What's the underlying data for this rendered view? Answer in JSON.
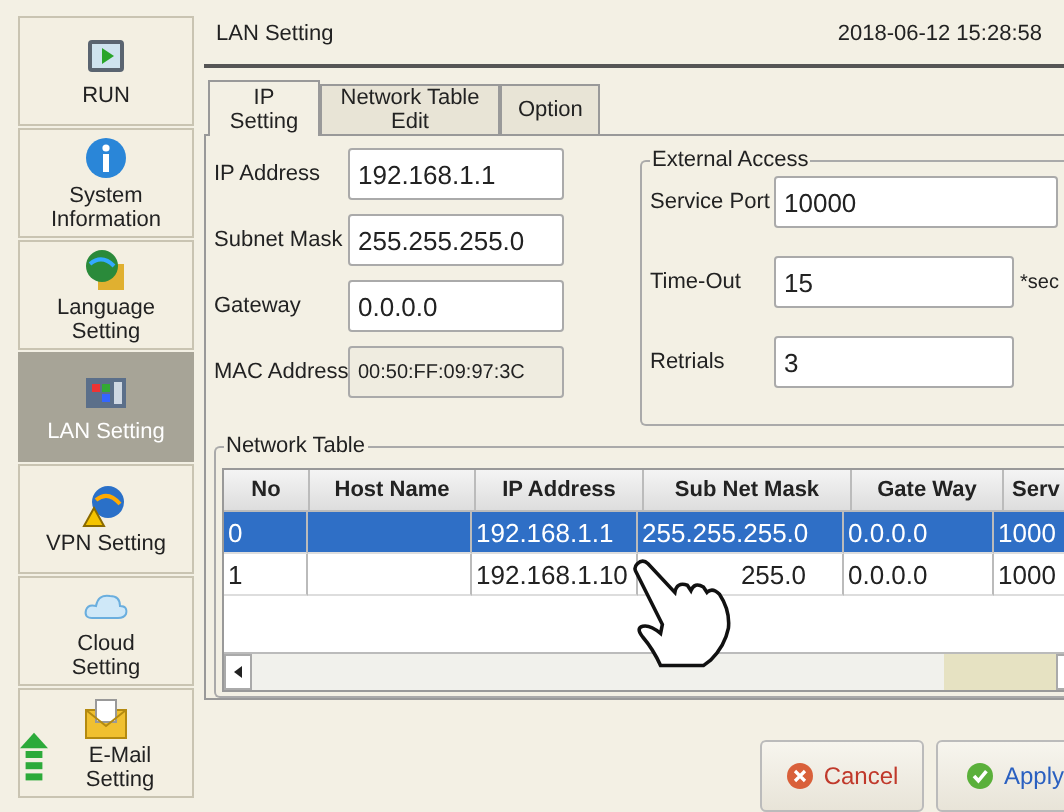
{
  "sidebar": {
    "items": [
      {
        "kind": "run",
        "label": "RUN",
        "selected": false
      },
      {
        "kind": "info",
        "label": "System Information",
        "selected": false
      },
      {
        "kind": "language",
        "label": "Language Setting",
        "selected": false
      },
      {
        "kind": "lan",
        "label": "LAN Setting",
        "selected": true
      },
      {
        "kind": "vpn",
        "label": "VPN Setting",
        "selected": false
      },
      {
        "kind": "cloud",
        "label": "Cloud Setting",
        "selected": false
      },
      {
        "kind": "mail",
        "label": "E-Mail Setting",
        "selected": false
      }
    ]
  },
  "header": {
    "title": "LAN Setting",
    "datetime": "2018-06-12  15:28:58"
  },
  "tabs": [
    {
      "label": "IP Setting",
      "selected": true
    },
    {
      "label": "Network Table Edit",
      "selected": false
    },
    {
      "label": "Option",
      "selected": false
    }
  ],
  "ip_fields": [
    {
      "label": "IP Address",
      "value": "192.168.1.1",
      "disabled": false
    },
    {
      "label": "Subnet Mask",
      "value": "255.255.255.0",
      "disabled": false
    },
    {
      "label": "Gateway",
      "value": "0.0.0.0",
      "disabled": false
    },
    {
      "label": "MAC Address",
      "value": "00:50:FF:09:97:3C",
      "disabled": true
    }
  ],
  "external_access": {
    "title": "External Access",
    "fields": [
      {
        "label": "Service Port",
        "value": "10000"
      },
      {
        "label": "Time-Out",
        "value": "15",
        "unit": "*sec"
      },
      {
        "label": "Retrials",
        "value": "3"
      }
    ]
  },
  "network_table": {
    "title": "Network Table",
    "columns": [
      "No",
      "Host Name",
      "IP Address",
      "Sub Net Mask",
      "Gate Way",
      "Serv"
    ],
    "rows": [
      {
        "selected": true,
        "cells": [
          "0",
          "",
          "192.168.1.1",
          "255.255.255.0",
          "0.0.0.0",
          "1000"
        ]
      },
      {
        "selected": false,
        "cells": [
          "1",
          "",
          "192.168.1.10",
          "255.0",
          "0.0.0.0",
          "1000"
        ]
      }
    ]
  },
  "buttons": [
    {
      "kind": "cancel",
      "label": "Cancel"
    },
    {
      "kind": "apply",
      "label": "Apply"
    }
  ]
}
